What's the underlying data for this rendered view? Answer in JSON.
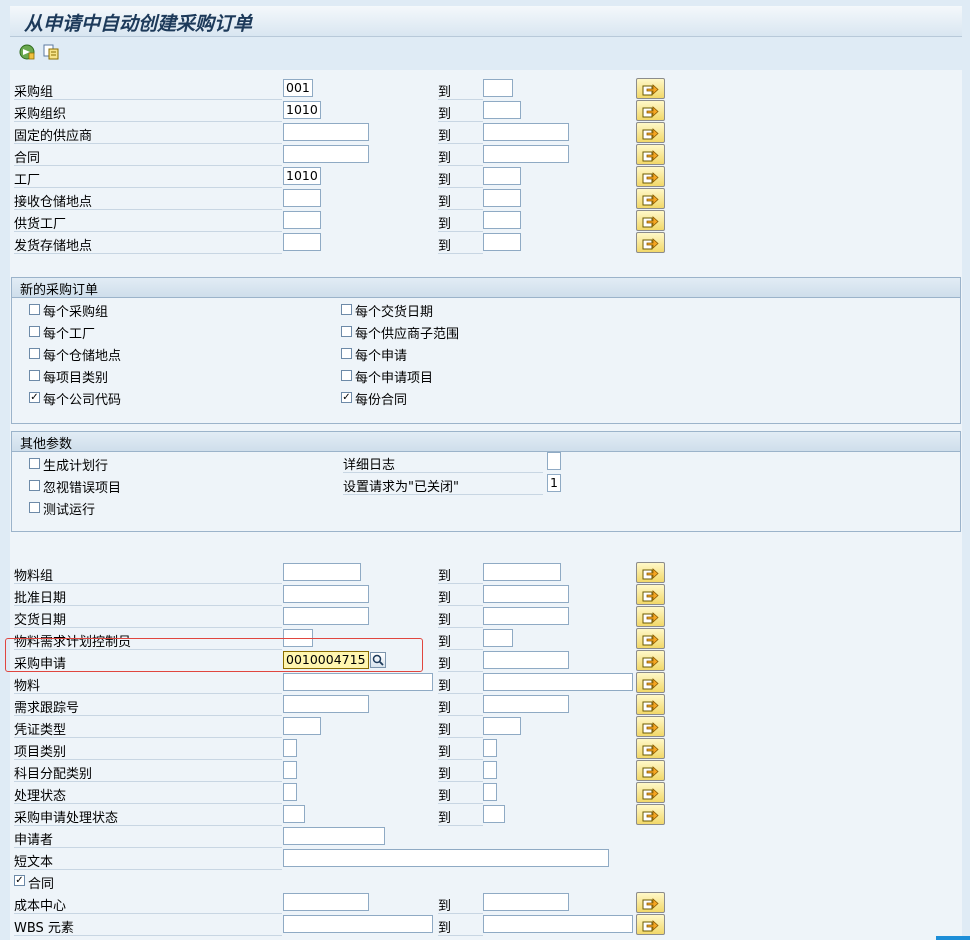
{
  "title": "从申请中自动创建采购订单",
  "toolbar": {
    "icons": [
      "execute-icon",
      "variant-icon"
    ]
  },
  "to_label": "到",
  "top_rows": [
    {
      "label": "采购组",
      "from": "001",
      "to": "",
      "fw": 30,
      "tw": 30
    },
    {
      "label": "采购组织",
      "from": "1010",
      "to": "",
      "fw": 38,
      "tw": 38
    },
    {
      "label": "固定的供应商",
      "from": "",
      "to": "",
      "fw": 86,
      "tw": 86
    },
    {
      "label": "合同",
      "from": "",
      "to": "",
      "fw": 86,
      "tw": 86
    },
    {
      "label": "工厂",
      "from": "1010",
      "to": "",
      "fw": 38,
      "tw": 38
    },
    {
      "label": "接收仓储地点",
      "from": "",
      "to": "",
      "fw": 38,
      "tw": 38
    },
    {
      "label": "供货工厂",
      "from": "",
      "to": "",
      "fw": 38,
      "tw": 38
    },
    {
      "label": "发货存储地点",
      "from": "",
      "to": "",
      "fw": 38,
      "tw": 38
    }
  ],
  "group_new_po": {
    "title": "新的采购订单",
    "left": [
      {
        "label": "每个采购组",
        "checked": false
      },
      {
        "label": "每个工厂",
        "checked": false
      },
      {
        "label": "每个仓储地点",
        "checked": false
      },
      {
        "label": "每项目类别",
        "checked": false
      },
      {
        "label": "每个公司代码",
        "checked": true
      }
    ],
    "right": [
      {
        "label": "每个交货日期",
        "checked": false
      },
      {
        "label": "每个供应商子范围",
        "checked": false
      },
      {
        "label": "每个申请",
        "checked": false
      },
      {
        "label": "每个申请项目",
        "checked": false
      },
      {
        "label": "每份合同",
        "checked": true
      }
    ]
  },
  "group_other": {
    "title": "其他参数",
    "left": [
      {
        "label": "生成计划行",
        "checked": false
      },
      {
        "label": "忽视错误项目",
        "checked": false
      },
      {
        "label": "测试运行",
        "checked": false
      }
    ],
    "right": [
      {
        "label": "详细日志",
        "value": ""
      },
      {
        "label": "设置请求为\"已关闭\"",
        "value": "1"
      }
    ]
  },
  "bottom_rows": [
    {
      "label": "物料组",
      "from": "",
      "to": "",
      "fw": 78,
      "tw": 78,
      "range": true
    },
    {
      "label": "批准日期",
      "from": "",
      "to": "",
      "fw": 86,
      "tw": 86,
      "range": true
    },
    {
      "label": "交货日期",
      "from": "",
      "to": "",
      "fw": 86,
      "tw": 86,
      "range": true
    },
    {
      "label": "物料需求计划控制员",
      "from": "",
      "to": "",
      "fw": 30,
      "tw": 30,
      "range": true
    },
    {
      "label": "采购申请",
      "from": "0010004715",
      "to": "",
      "fw": 86,
      "tw": 86,
      "range": true,
      "highlight": true
    },
    {
      "label": "物料",
      "from": "",
      "to": "",
      "fw": 150,
      "tw": 150,
      "range": true
    },
    {
      "label": "需求跟踪号",
      "from": "",
      "to": "",
      "fw": 86,
      "tw": 86,
      "range": true
    },
    {
      "label": "凭证类型",
      "from": "",
      "to": "",
      "fw": 38,
      "tw": 38,
      "range": true
    },
    {
      "label": "项目类别",
      "from": "",
      "to": "",
      "fw": 14,
      "tw": 14,
      "range": true
    },
    {
      "label": "科目分配类别",
      "from": "",
      "to": "",
      "fw": 14,
      "tw": 14,
      "range": true
    },
    {
      "label": "处理状态",
      "from": "",
      "to": "",
      "fw": 14,
      "tw": 14,
      "range": true
    },
    {
      "label": "采购申请处理状态",
      "from": "",
      "to": "",
      "fw": 22,
      "tw": 22,
      "range": true
    },
    {
      "label": "申请者",
      "from": "",
      "fw": 102,
      "range": false
    },
    {
      "label": "短文本",
      "from": "",
      "fw": 326,
      "range": false
    },
    {
      "label": "合同",
      "checkbox": true,
      "checked": true
    },
    {
      "label": "成本中心",
      "from": "",
      "to": "",
      "fw": 86,
      "tw": 86,
      "range": true
    },
    {
      "label": "WBS 元素",
      "from": "",
      "to": "",
      "fw": 150,
      "tw": 150,
      "range": true
    }
  ]
}
